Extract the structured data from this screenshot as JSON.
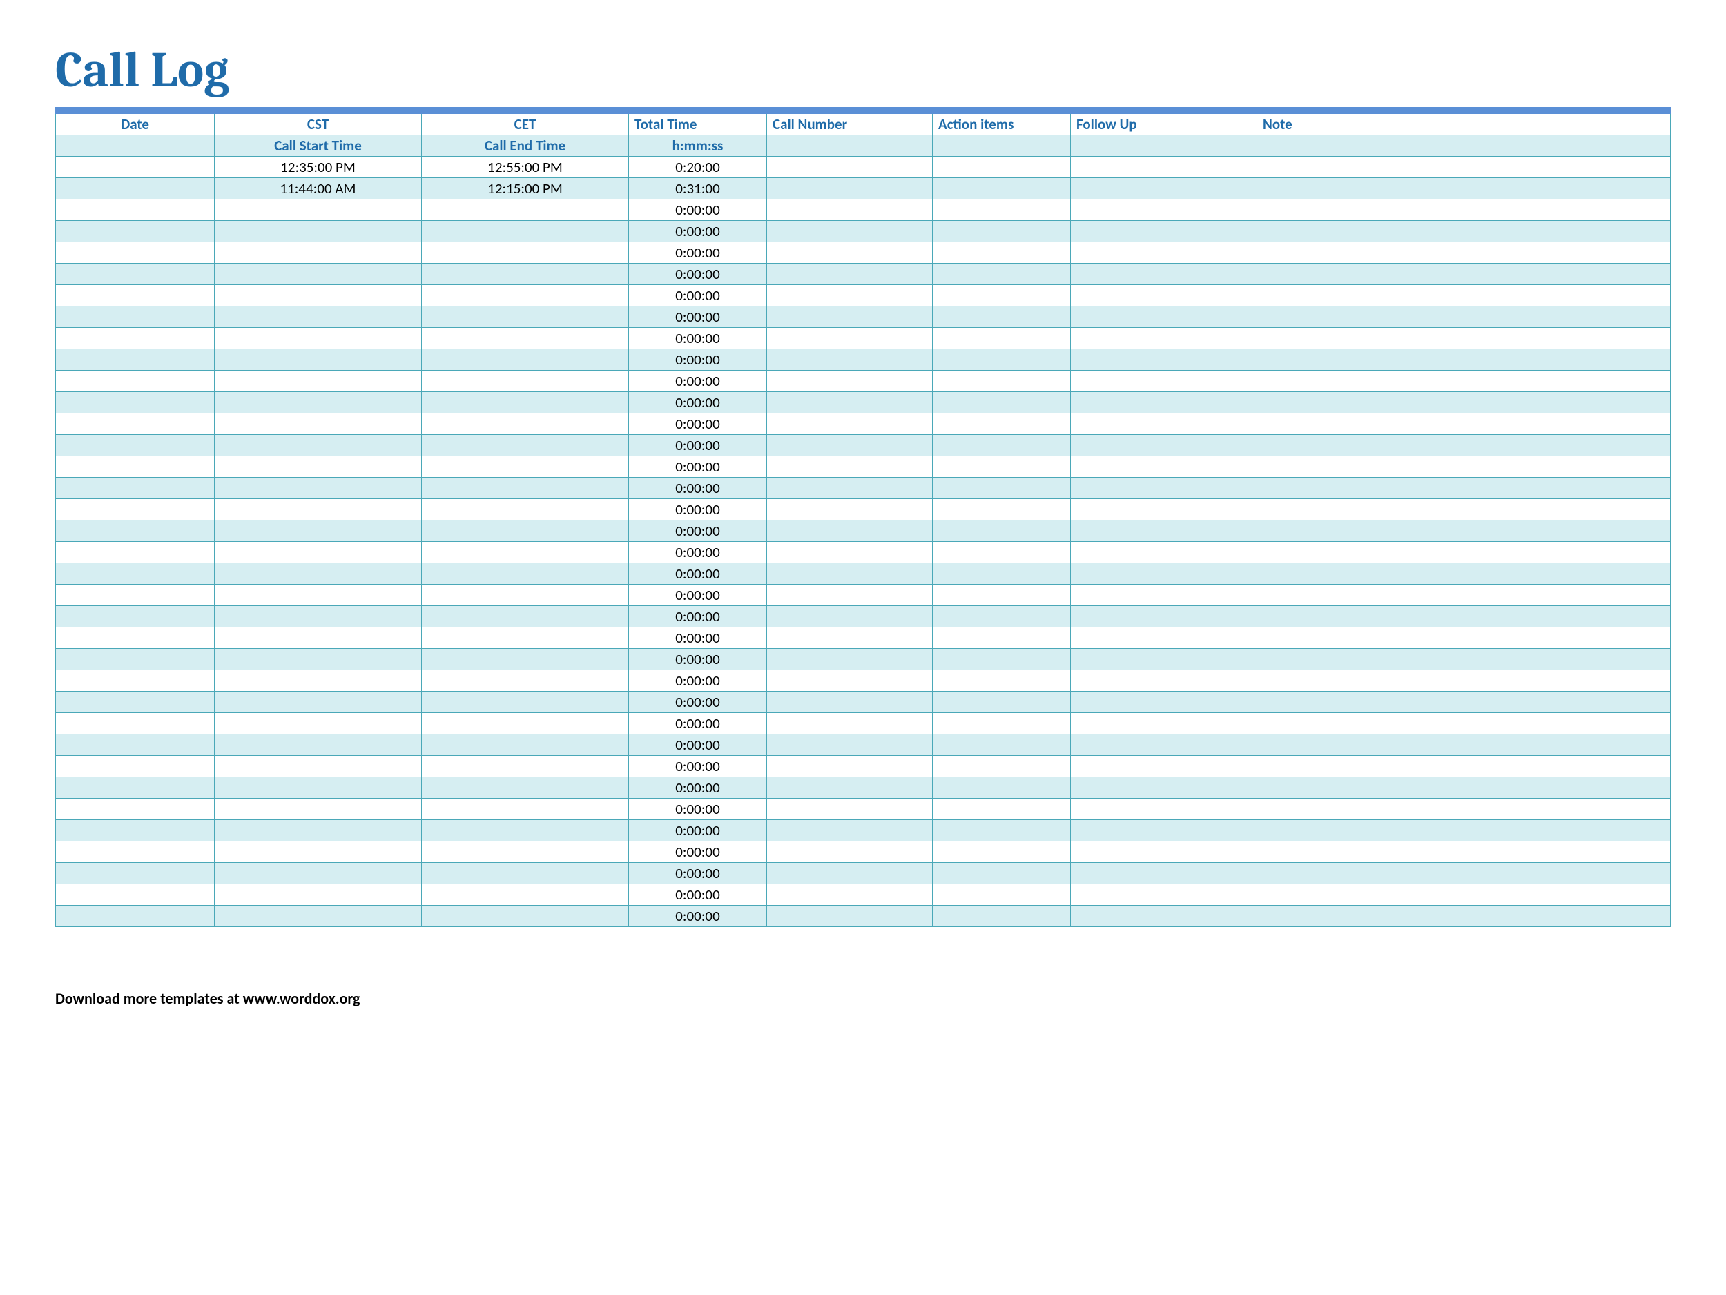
{
  "title": "Call Log",
  "columns": {
    "date": "Date",
    "cst": "CST",
    "cet": "CET",
    "total": "Total Time",
    "num": "Call Number",
    "act": "Action items",
    "fu": "Follow Up",
    "note": "Note"
  },
  "sub": {
    "date": "",
    "cst": "Call Start Time",
    "cet": "Call End Time",
    "total": "h:mm:ss",
    "num": "",
    "act": "",
    "fu": "",
    "note": ""
  },
  "rows": [
    {
      "date": "",
      "cst": "12:35:00 PM",
      "cet": "12:55:00 PM",
      "total": "0:20:00",
      "num": "",
      "act": "",
      "fu": "",
      "note": ""
    },
    {
      "date": "",
      "cst": "11:44:00 AM",
      "cet": "12:15:00 PM",
      "total": "0:31:00",
      "num": "",
      "act": "",
      "fu": "",
      "note": ""
    },
    {
      "date": "",
      "cst": "",
      "cet": "",
      "total": "0:00:00",
      "num": "",
      "act": "",
      "fu": "",
      "note": ""
    },
    {
      "date": "",
      "cst": "",
      "cet": "",
      "total": "0:00:00",
      "num": "",
      "act": "",
      "fu": "",
      "note": ""
    },
    {
      "date": "",
      "cst": "",
      "cet": "",
      "total": "0:00:00",
      "num": "",
      "act": "",
      "fu": "",
      "note": ""
    },
    {
      "date": "",
      "cst": "",
      "cet": "",
      "total": "0:00:00",
      "num": "",
      "act": "",
      "fu": "",
      "note": ""
    },
    {
      "date": "",
      "cst": "",
      "cet": "",
      "total": "0:00:00",
      "num": "",
      "act": "",
      "fu": "",
      "note": ""
    },
    {
      "date": "",
      "cst": "",
      "cet": "",
      "total": "0:00:00",
      "num": "",
      "act": "",
      "fu": "",
      "note": ""
    },
    {
      "date": "",
      "cst": "",
      "cet": "",
      "total": "0:00:00",
      "num": "",
      "act": "",
      "fu": "",
      "note": ""
    },
    {
      "date": "",
      "cst": "",
      "cet": "",
      "total": "0:00:00",
      "num": "",
      "act": "",
      "fu": "",
      "note": ""
    },
    {
      "date": "",
      "cst": "",
      "cet": "",
      "total": "0:00:00",
      "num": "",
      "act": "",
      "fu": "",
      "note": ""
    },
    {
      "date": "",
      "cst": "",
      "cet": "",
      "total": "0:00:00",
      "num": "",
      "act": "",
      "fu": "",
      "note": ""
    },
    {
      "date": "",
      "cst": "",
      "cet": "",
      "total": "0:00:00",
      "num": "",
      "act": "",
      "fu": "",
      "note": ""
    },
    {
      "date": "",
      "cst": "",
      "cet": "",
      "total": "0:00:00",
      "num": "",
      "act": "",
      "fu": "",
      "note": ""
    },
    {
      "date": "",
      "cst": "",
      "cet": "",
      "total": "0:00:00",
      "num": "",
      "act": "",
      "fu": "",
      "note": ""
    },
    {
      "date": "",
      "cst": "",
      "cet": "",
      "total": "0:00:00",
      "num": "",
      "act": "",
      "fu": "",
      "note": ""
    },
    {
      "date": "",
      "cst": "",
      "cet": "",
      "total": "0:00:00",
      "num": "",
      "act": "",
      "fu": "",
      "note": ""
    },
    {
      "date": "",
      "cst": "",
      "cet": "",
      "total": "0:00:00",
      "num": "",
      "act": "",
      "fu": "",
      "note": ""
    },
    {
      "date": "",
      "cst": "",
      "cet": "",
      "total": "0:00:00",
      "num": "",
      "act": "",
      "fu": "",
      "note": ""
    },
    {
      "date": "",
      "cst": "",
      "cet": "",
      "total": "0:00:00",
      "num": "",
      "act": "",
      "fu": "",
      "note": ""
    },
    {
      "date": "",
      "cst": "",
      "cet": "",
      "total": "0:00:00",
      "num": "",
      "act": "",
      "fu": "",
      "note": ""
    },
    {
      "date": "",
      "cst": "",
      "cet": "",
      "total": "0:00:00",
      "num": "",
      "act": "",
      "fu": "",
      "note": ""
    },
    {
      "date": "",
      "cst": "",
      "cet": "",
      "total": "0:00:00",
      "num": "",
      "act": "",
      "fu": "",
      "note": ""
    },
    {
      "date": "",
      "cst": "",
      "cet": "",
      "total": "0:00:00",
      "num": "",
      "act": "",
      "fu": "",
      "note": ""
    },
    {
      "date": "",
      "cst": "",
      "cet": "",
      "total": "0:00:00",
      "num": "",
      "act": "",
      "fu": "",
      "note": ""
    },
    {
      "date": "",
      "cst": "",
      "cet": "",
      "total": "0:00:00",
      "num": "",
      "act": "",
      "fu": "",
      "note": ""
    },
    {
      "date": "",
      "cst": "",
      "cet": "",
      "total": "0:00:00",
      "num": "",
      "act": "",
      "fu": "",
      "note": ""
    },
    {
      "date": "",
      "cst": "",
      "cet": "",
      "total": "0:00:00",
      "num": "",
      "act": "",
      "fu": "",
      "note": ""
    },
    {
      "date": "",
      "cst": "",
      "cet": "",
      "total": "0:00:00",
      "num": "",
      "act": "",
      "fu": "",
      "note": ""
    },
    {
      "date": "",
      "cst": "",
      "cet": "",
      "total": "0:00:00",
      "num": "",
      "act": "",
      "fu": "",
      "note": ""
    },
    {
      "date": "",
      "cst": "",
      "cet": "",
      "total": "0:00:00",
      "num": "",
      "act": "",
      "fu": "",
      "note": ""
    },
    {
      "date": "",
      "cst": "",
      "cet": "",
      "total": "0:00:00",
      "num": "",
      "act": "",
      "fu": "",
      "note": ""
    },
    {
      "date": "",
      "cst": "",
      "cet": "",
      "total": "0:00:00",
      "num": "",
      "act": "",
      "fu": "",
      "note": ""
    },
    {
      "date": "",
      "cst": "",
      "cet": "",
      "total": "0:00:00",
      "num": "",
      "act": "",
      "fu": "",
      "note": ""
    },
    {
      "date": "",
      "cst": "",
      "cet": "",
      "total": "0:00:00",
      "num": "",
      "act": "",
      "fu": "",
      "note": ""
    },
    {
      "date": "",
      "cst": "",
      "cet": "",
      "total": "0:00:00",
      "num": "",
      "act": "",
      "fu": "",
      "note": ""
    }
  ],
  "footer": "Download more templates at www.worddox.org"
}
